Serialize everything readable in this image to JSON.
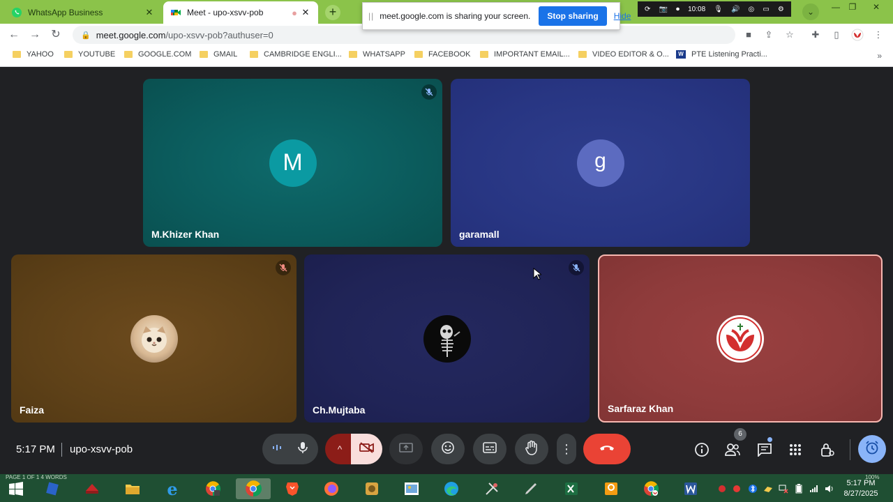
{
  "tabs": [
    {
      "title": "WhatsApp Business",
      "favicon": "whatsapp-icon",
      "active": false
    },
    {
      "title": "Meet - upo-xsvv-pob",
      "favicon": "meet-icon",
      "active": true
    }
  ],
  "share_banner": {
    "message": "meet.google.com is sharing your screen.",
    "stop_label": "Stop sharing",
    "hide_label": "Hide"
  },
  "recorder": {
    "time": "10:08"
  },
  "address": {
    "host": "meet.google.com",
    "path": "/upo-xsvv-pob?authuser=0"
  },
  "bookmarks": [
    "YAHOO",
    "YOUTUBE",
    "GOOGLE.COM",
    "GMAIL",
    "CAMBRIDGE ENGLI...",
    "WHATSAPP",
    "FACEBOOK",
    "IMPORTANT EMAIL...",
    "VIDEO EDITOR & O...",
    "PTE Listening Practi..."
  ],
  "participants": [
    {
      "name": "M.Khizer Khan",
      "initial": "M",
      "muted": true,
      "color": "#0b9aa2"
    },
    {
      "name": "garamall",
      "initial": "g",
      "muted": false,
      "color": "#5c6bc0"
    },
    {
      "name": "Faiza",
      "avatar": "cat-photo",
      "muted": true
    },
    {
      "name": "Ch.Mujtaba",
      "avatar": "skeleton-photo",
      "muted": true
    },
    {
      "name": "Sarfaraz Khan",
      "avatar": "red-logo",
      "muted": false,
      "highlight": true
    }
  ],
  "meeting": {
    "time": "5:17 PM",
    "code": "upo-xsvv-pob",
    "participant_count": "6"
  },
  "taskbar": {
    "status": "PAGE 1 OF 1    4 WORDS",
    "clock_time": "5:17 PM",
    "clock_date": "8/27/2025",
    "battery": "100%"
  },
  "colors": {
    "leave_red": "#ea4335",
    "chrome_green": "#8bc34a",
    "meet_bg": "#202124",
    "accent_blue": "#8ab4f8"
  }
}
